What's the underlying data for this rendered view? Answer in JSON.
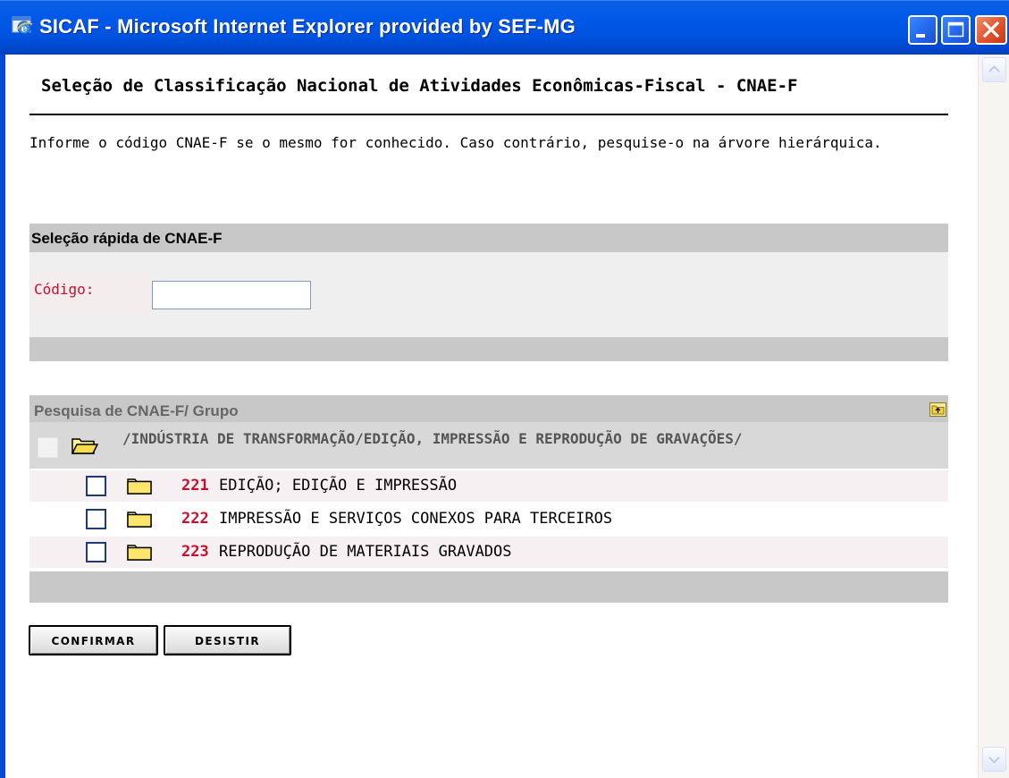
{
  "window": {
    "title": "SICAF - Microsoft Internet Explorer provided by SEF-MG",
    "icon": "internet-explorer-icon",
    "controls": [
      "minimize-icon",
      "maximize-icon",
      "close-icon"
    ]
  },
  "page": {
    "title": "Seleção de Classificação Nacional de Atividades Econômicas-Fiscal - CNAE-F",
    "info": "Informe o código CNAE-F se o mesmo for conhecido. Caso contrário, pesquise-o na árvore hierárquica."
  },
  "quick_select": {
    "header": "Seleção rápida de CNAE-F",
    "code_label": "Código:",
    "code_value": ""
  },
  "search": {
    "header": "Pesquisa de CNAE-F/ Grupo",
    "up_icon": "folder-up-icon",
    "path": "/INDÚSTRIA DE TRANSFORMAÇÃO/EDIÇÃO, IMPRESSÃO E REPRODUÇÃO DE GRAVAÇÕES/",
    "items": [
      {
        "code": "221",
        "name": "EDIÇÃO; EDIÇÃO E IMPRESSÃO"
      },
      {
        "code": "222",
        "name": "IMPRESSÃO E SERVIÇOS CONEXOS PARA TERCEIROS"
      },
      {
        "code": "223",
        "name": "REPRODUÇÃO DE MATERIAIS GRAVADOS"
      }
    ]
  },
  "buttons": {
    "confirm": "CONFIRMAR",
    "cancel": "DESISTIR"
  },
  "colors": {
    "titlebar": "#0052dd",
    "code_red": "#c8102e",
    "section_gray": "#c8c8c8"
  }
}
